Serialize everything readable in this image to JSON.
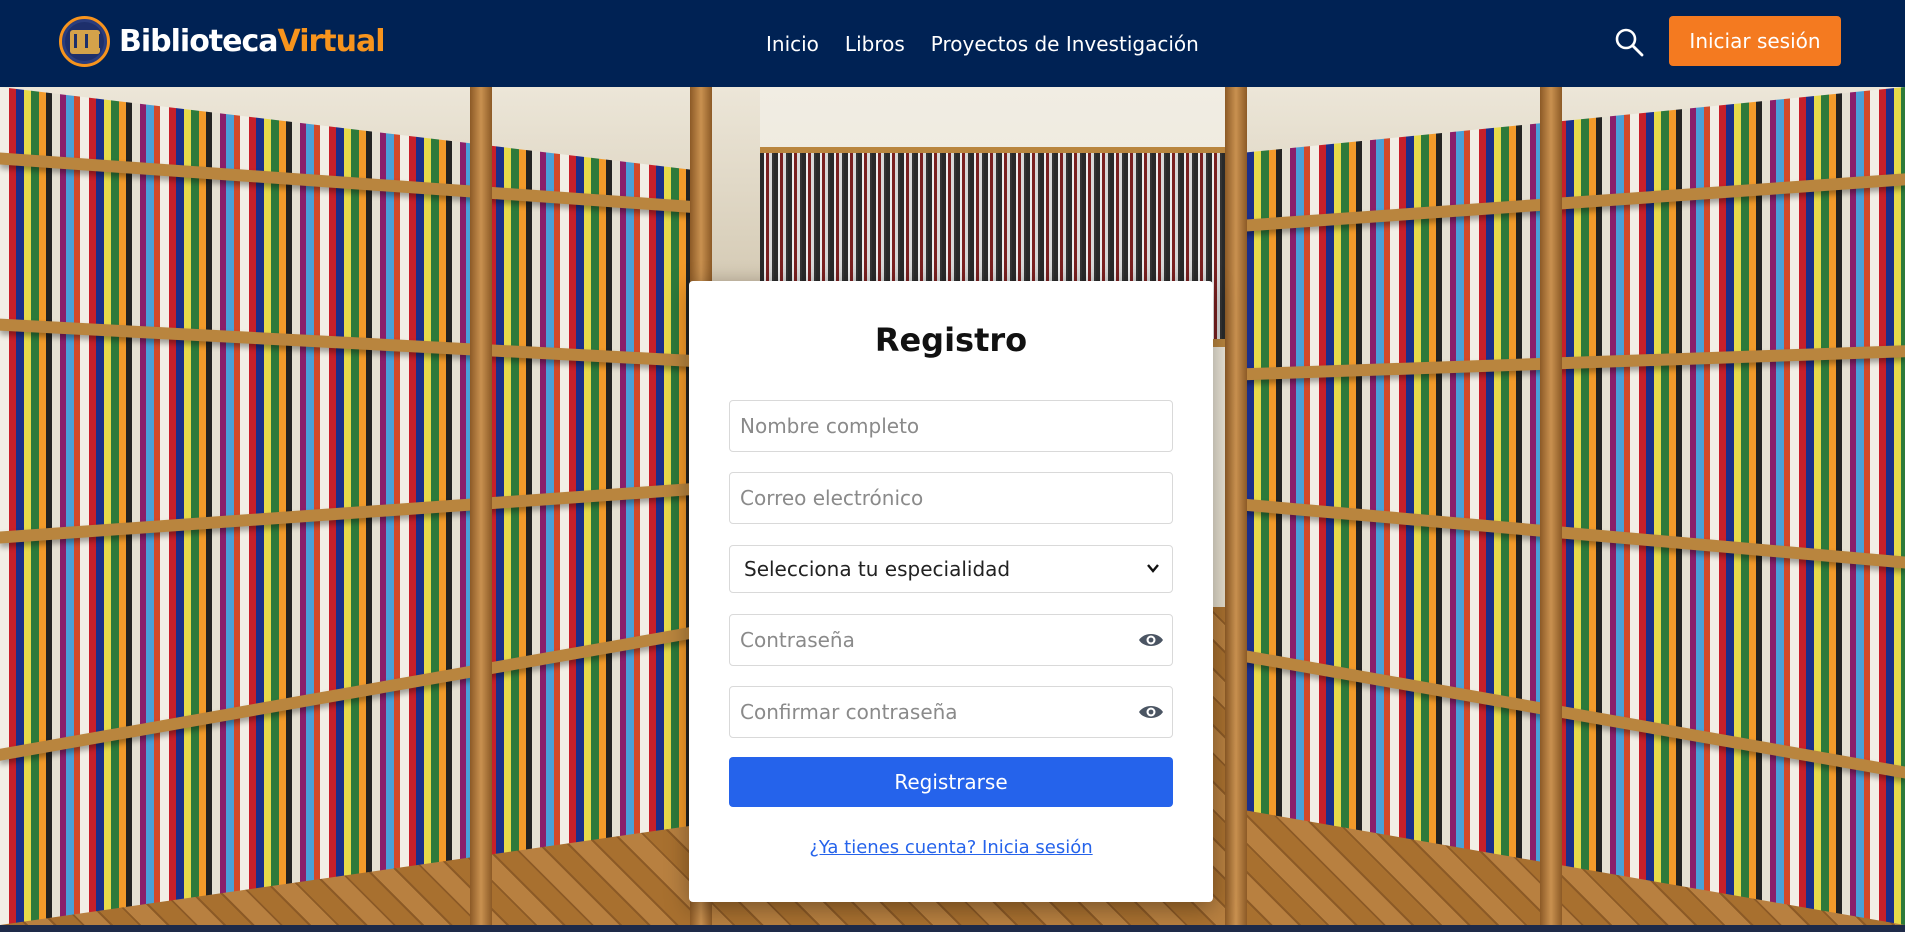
{
  "header": {
    "brand_part1": "Biblioteca",
    "brand_part2": "Virtual",
    "nav": [
      "Inicio",
      "Libros",
      "Proyectos de Investigación"
    ],
    "login_label": "Iniciar sesión",
    "search_icon": "search-icon"
  },
  "register": {
    "title": "Registro",
    "name_placeholder": "Nombre completo",
    "email_placeholder": "Correo electrónico",
    "specialty_selected": "Selecciona tu especialidad",
    "password_placeholder": "Contraseña",
    "confirm_placeholder": "Confirmar contraseña",
    "submit_label": "Registrarse",
    "login_link": "¿Ya tienes cuenta? Inicia sesión"
  },
  "colors": {
    "navbar": "#002254",
    "accent_orange": "#f47a20",
    "primary_blue": "#2563eb"
  }
}
